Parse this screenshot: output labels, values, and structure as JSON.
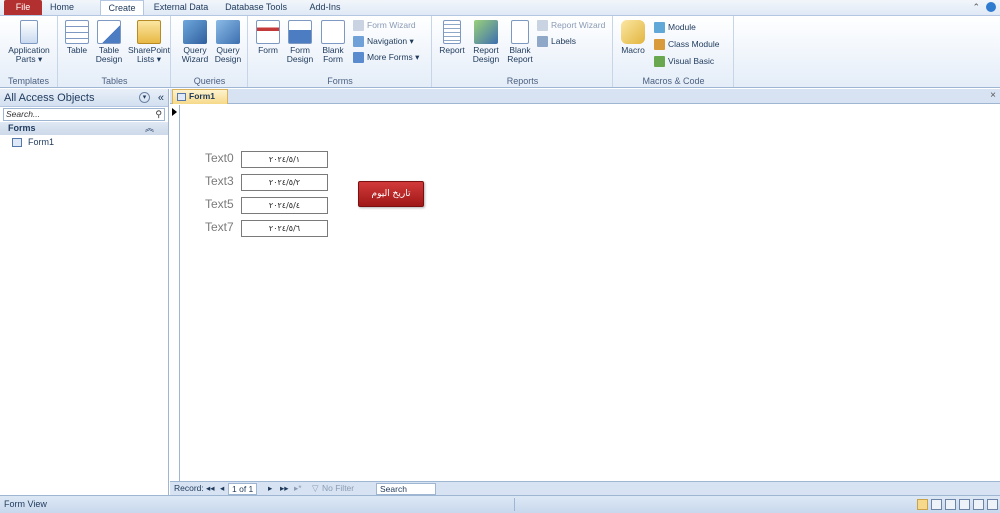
{
  "ribbon_tabs": {
    "file": "File",
    "home": "Home",
    "create": "Create",
    "external": "External Data",
    "dbtools": "Database Tools",
    "addins": "Add-Ins"
  },
  "ribbon": {
    "templates": {
      "label": "Templates",
      "application_parts": "Application Parts ▾"
    },
    "tables": {
      "label": "Tables",
      "table": "Table",
      "table_design": "Table Design",
      "sharepoint_lists": "SharePoint Lists ▾"
    },
    "queries": {
      "label": "Queries",
      "query_wizard": "Query Wizard",
      "query_design": "Query Design"
    },
    "forms": {
      "label": "Forms",
      "form": "Form",
      "form_design": "Form Design",
      "blank_form": "Blank Form",
      "form_wizard": "Form Wizard",
      "navigation": "Navigation ▾",
      "more_forms": "More Forms ▾"
    },
    "reports": {
      "label": "Reports",
      "report": "Report",
      "report_design": "Report Design",
      "blank_report": "Blank Report",
      "report_wizard": "Report Wizard",
      "labels": "Labels"
    },
    "macros": {
      "label": "Macros & Code",
      "macro": "Macro",
      "module": "Module",
      "class_module": "Class Module",
      "visual_basic": "Visual Basic"
    }
  },
  "nav_pane": {
    "title": "All Access Objects",
    "search_placeholder": "Search...",
    "group": "Forms",
    "items": [
      "Form1"
    ]
  },
  "document": {
    "tab": "Form1",
    "fields": [
      {
        "label": "Text0",
        "value": "٢٠٢٤/٥/١"
      },
      {
        "label": "Text3",
        "value": "٢٠٢٤/٥/٢"
      },
      {
        "label": "Text5",
        "value": "٢٠٢٤/٥/٤"
      },
      {
        "label": "Text7",
        "value": "٢٠٢٤/٥/٦"
      }
    ],
    "button": "تاريخ اليوم"
  },
  "record_nav": {
    "prefix": "Record:",
    "first": "◂◂",
    "prev": "◂",
    "current": "1 of 1",
    "next": "▸",
    "last": "▸▸",
    "new": "▸*",
    "filter": "No Filter",
    "search": "Search"
  },
  "status": {
    "view": "Form View"
  },
  "colors": {
    "file_tab": "#b33030",
    "button_red": "#c02828",
    "ribbon_bg": "#e4edf8"
  }
}
